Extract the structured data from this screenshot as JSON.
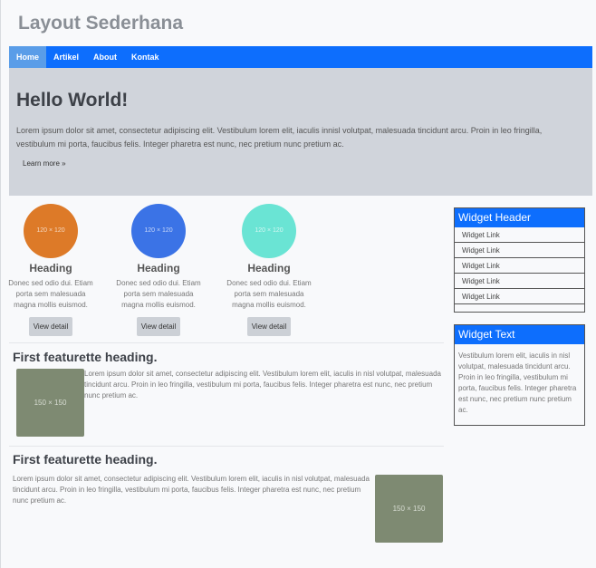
{
  "site": {
    "title": "Layout Sederhana"
  },
  "nav": {
    "items": [
      "Home",
      "Artikel",
      "About",
      "Kontak"
    ]
  },
  "hero": {
    "title": "Hello World!",
    "text": "Lorem ipsum dolor sit amet, consectetur adipiscing elit. Vestibulum lorem elit, iaculis innisl volutpat, malesuada tincidunt arcu. Proin in leo fringilla, vestibulum mi porta, faucibus felis. Integer pharetra est nunc, nec pretium nunc pretium ac.",
    "button": "Learn more »"
  },
  "columns": [
    {
      "image_label": "120 × 120",
      "color": "#dd7a28",
      "heading": "Heading",
      "text": "Donec sed odio dui. Etiam porta sem malesuada magna mollis euismod.",
      "button": "View detail"
    },
    {
      "image_label": "120 × 120",
      "color": "#3b73e6",
      "heading": "Heading",
      "text": "Donec sed odio dui. Etiam porta sem malesuada magna mollis euismod.",
      "button": "View detail"
    },
    {
      "image_label": "120 × 120",
      "color": "#6ae4d4",
      "heading": "Heading",
      "text": "Donec sed odio dui. Etiam porta sem malesuada magna mollis euismod.",
      "button": "View detail"
    }
  ],
  "featurettes": [
    {
      "heading": "First featurette heading.",
      "image_label": "150 × 150",
      "text": "Lorem ipsum dolor sit amet, consectetur adipiscing elit. Vestibulum lorem elit, iaculis in nisl volutpat, malesuada tincidunt arcu. Proin in leo fringilla, vestibulum mi porta, faucibus felis. Integer pharetra est nunc, nec pretium nunc pretium ac."
    },
    {
      "heading": "First featurette heading.",
      "image_label": "150 × 150",
      "text": "Lorem ipsum dolor sit amet, consectetur adipiscing elit. Vestibulum lorem elit, iaculis in nisl volutpat, malesuada tincidunt arcu. Proin in leo fringilla, vestibulum mi porta, faucibus felis. Integer pharetra est nunc, nec pretium nunc pretium ac."
    }
  ],
  "widgets": {
    "links": {
      "header": "Widget Header",
      "items": [
        "Widget Link",
        "Widget Link",
        "Widget Link",
        "Widget Link",
        "Widget Link"
      ]
    },
    "text": {
      "header": "Widget Text",
      "body": "Vestibulum lorem elit, iaculis in nisl volutpat, malesuada tincidunt arcu. Proin in leo fringilla, vestibulum mi porta, faucibus felis. Integer pharetra est nunc, nec pretium nunc pretium ac."
    }
  },
  "colors": {
    "primary": "#0d6efd",
    "nav_active": "#5a9de8",
    "hero_bg": "#d0d4db",
    "placeholder": "#7e8a72"
  }
}
